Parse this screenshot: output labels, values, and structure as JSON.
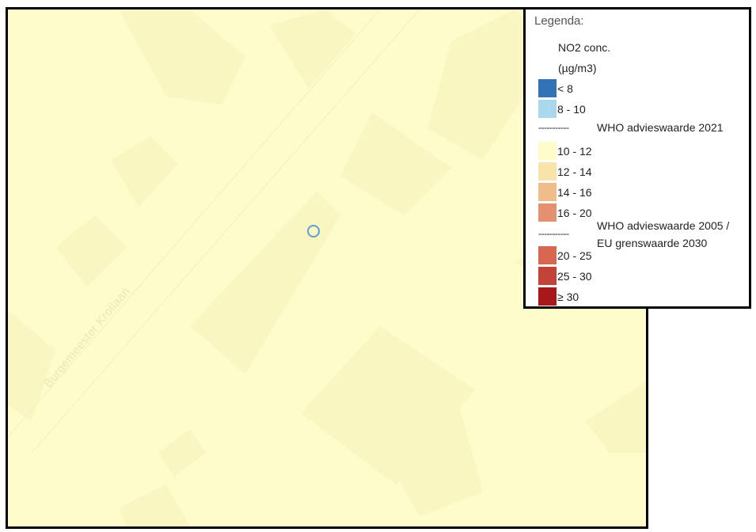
{
  "map": {
    "street_name": "Burgemeester Krollaan",
    "background_color": "#fefccb",
    "building_color": "#faf5c0"
  },
  "legend": {
    "title": "Legenda:",
    "subtitle_line1": "NO2 conc.",
    "subtitle_line2": "(µg/m3)",
    "classes": [
      {
        "label": "< 8",
        "color": "#3273b6"
      },
      {
        "label": "8 - 10",
        "color": "#a9d7ec"
      },
      {
        "label": "10 - 12",
        "color": "#fefccb"
      },
      {
        "label": "12 - 14",
        "color": "#f8e3aa"
      },
      {
        "label": "14 - 16",
        "color": "#f0bd8a"
      },
      {
        "label": "16 - 20",
        "color": "#e4916f"
      },
      {
        "label": "20 - 25",
        "color": "#d7684f"
      },
      {
        "label": "25 - 30",
        "color": "#c24439"
      },
      {
        "label": "≥ 30",
        "color": "#a8171a"
      }
    ],
    "threshold_1": {
      "dash": "-----------",
      "label": "WHO advieswaarde 2021"
    },
    "threshold_2": {
      "dash": "-----------",
      "label_line1": "WHO advieswaarde 2005 /",
      "label_line2": "EU grenswaarde 2030"
    }
  }
}
